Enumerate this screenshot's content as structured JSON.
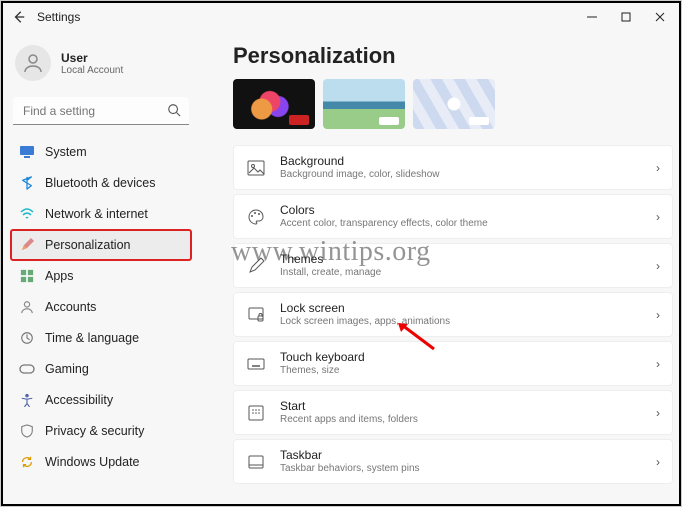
{
  "window": {
    "title": "Settings"
  },
  "user": {
    "name": "User",
    "subtitle": "Local Account"
  },
  "search": {
    "placeholder": "Find a setting"
  },
  "nav": {
    "system": "System",
    "bluetooth": "Bluetooth & devices",
    "network": "Network & internet",
    "personalization": "Personalization",
    "apps": "Apps",
    "accounts": "Accounts",
    "time": "Time & language",
    "gaming": "Gaming",
    "accessibility": "Accessibility",
    "privacy": "Privacy & security",
    "update": "Windows Update"
  },
  "page": {
    "title": "Personalization"
  },
  "cards": {
    "background": {
      "title": "Background",
      "sub": "Background image, color, slideshow"
    },
    "colors": {
      "title": "Colors",
      "sub": "Accent color, transparency effects, color theme"
    },
    "themes": {
      "title": "Themes",
      "sub": "Install, create, manage"
    },
    "lockscreen": {
      "title": "Lock screen",
      "sub": "Lock screen images, apps, animations"
    },
    "touchkb": {
      "title": "Touch keyboard",
      "sub": "Themes, size"
    },
    "start": {
      "title": "Start",
      "sub": "Recent apps and items, folders"
    },
    "taskbar": {
      "title": "Taskbar",
      "sub": "Taskbar behaviors, system pins"
    }
  },
  "watermark": "www.wintips.org"
}
